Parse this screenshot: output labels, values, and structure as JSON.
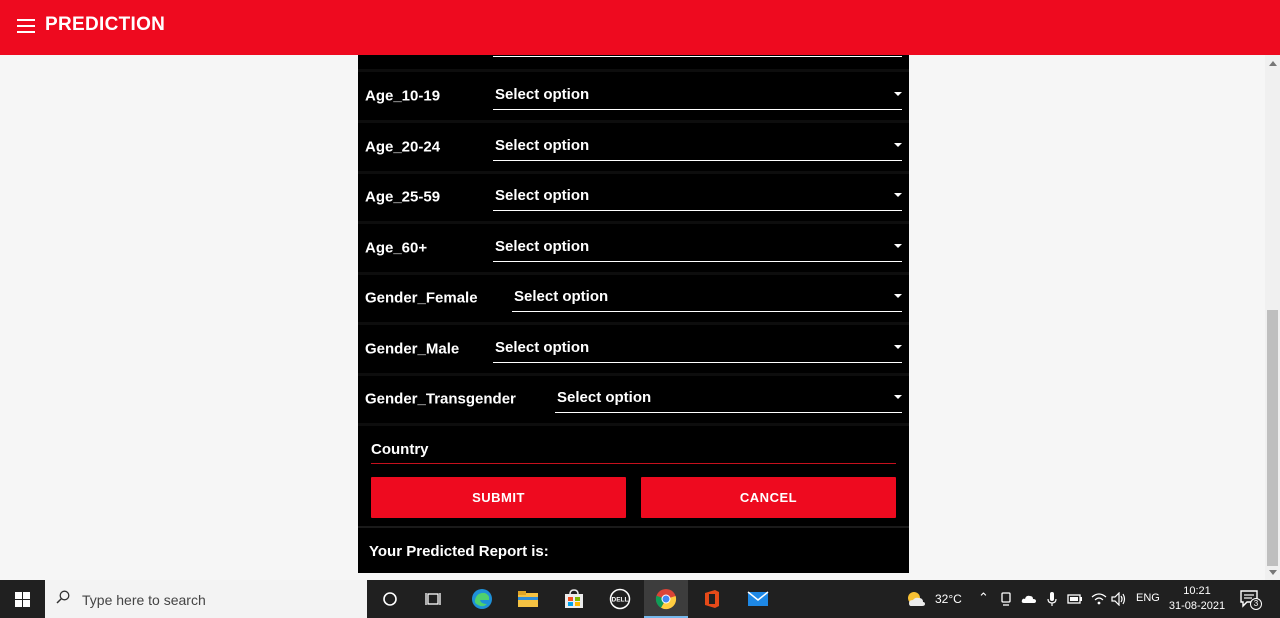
{
  "header": {
    "title": "PREDICTION"
  },
  "form": {
    "rows": [
      {
        "label": "Age_10-19",
        "value": "Select option"
      },
      {
        "label": "Age_20-24",
        "value": "Select option"
      },
      {
        "label": "Age_25-59",
        "value": "Select option"
      },
      {
        "label": "Age_60+",
        "value": "Select option"
      },
      {
        "label": "Gender_Female",
        "value": "Select option"
      },
      {
        "label": "Gender_Male",
        "value": "Select option"
      },
      {
        "label": "Gender_Transgender",
        "value": "Select option"
      }
    ],
    "country_label": "Country",
    "submit_label": "SUBMIT",
    "cancel_label": "CANCEL",
    "result_label": "Your Predicted Report is:"
  },
  "colors": {
    "accent": "#ee0a1f",
    "panel": "#000000",
    "page_bg": "#f6f6f6"
  },
  "taskbar": {
    "search_placeholder": "Type here to search",
    "weather": "32°C",
    "language": "ENG",
    "time": "10:21",
    "date": "31-08-2021",
    "notification_count": "3",
    "icons": [
      "cortana-icon",
      "task-view-icon",
      "edge-icon",
      "file-explorer-icon",
      "store-icon",
      "dell-icon",
      "chrome-icon",
      "office-icon",
      "mail-icon"
    ]
  }
}
